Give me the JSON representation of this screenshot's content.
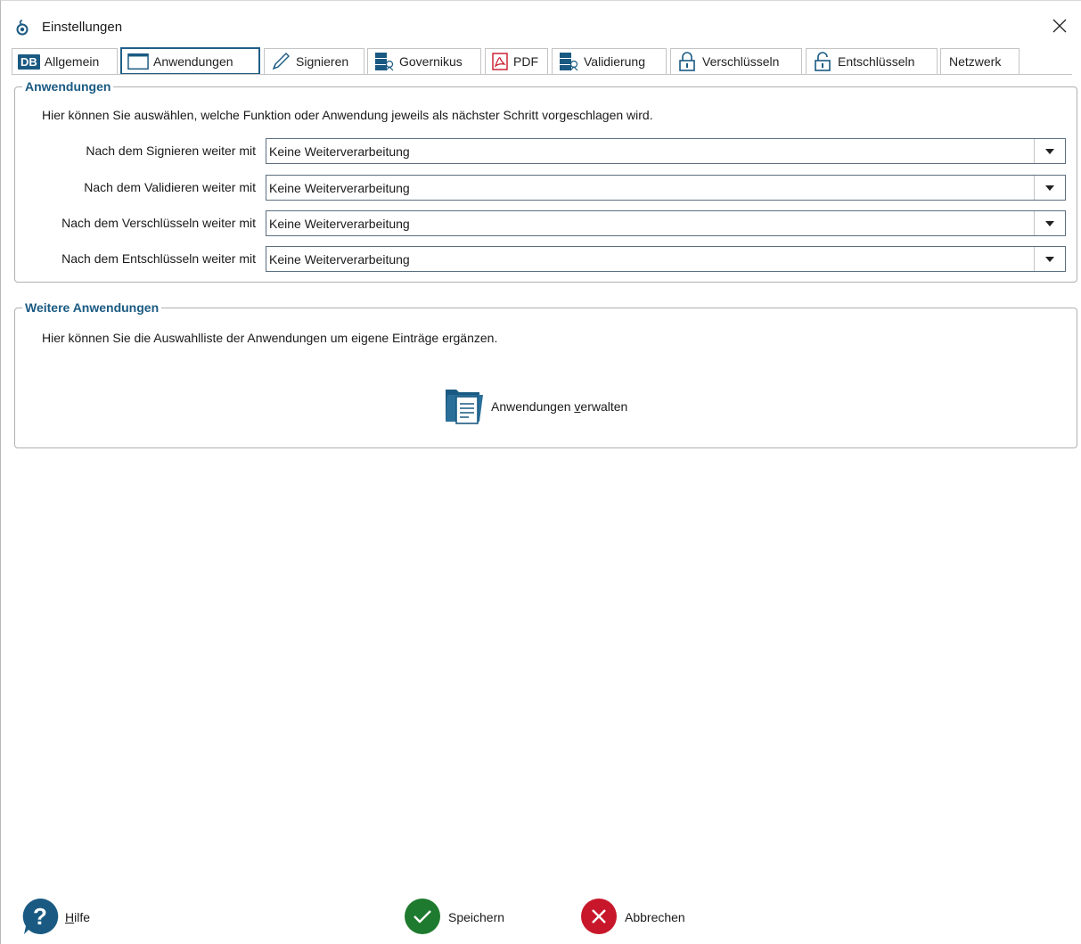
{
  "window": {
    "title": "Einstellungen",
    "title_icon": "app-logo-icon",
    "close_icon": "close-icon"
  },
  "tabs": [
    {
      "label": "Allgemein",
      "icon": "db-icon",
      "badge": "DB"
    },
    {
      "label": "Anwendungen",
      "icon": "window-icon",
      "active": true
    },
    {
      "label": "Signieren",
      "icon": "pen-icon"
    },
    {
      "label": "Governikus",
      "icon": "server-icon"
    },
    {
      "label": "PDF",
      "icon": "pdf-icon"
    },
    {
      "label": "Validierung",
      "icon": "server-check-icon"
    },
    {
      "label": "Verschlüsseln",
      "icon": "lock-closed-icon"
    },
    {
      "label": "Entschlüsseln",
      "icon": "lock-open-icon"
    },
    {
      "label": "Netzwerk",
      "icon": ""
    }
  ],
  "anwendungen": {
    "title": "Anwendungen",
    "description": "Hier können Sie auswählen, welche Funktion oder Anwendung jeweils als nächster Schritt vorgeschlagen wird.",
    "rows": [
      {
        "label": "Nach dem Signieren weiter mit",
        "value": "Keine Weiterverarbeitung"
      },
      {
        "label": "Nach dem Validieren weiter mit",
        "value": "Keine Weiterverarbeitung"
      },
      {
        "label": "Nach dem Verschlüsseln weiter mit",
        "value": "Keine Weiterverarbeitung"
      },
      {
        "label": "Nach dem Entschlüsseln weiter mit",
        "value": "Keine Weiterverarbeitung"
      }
    ]
  },
  "weitere": {
    "title": "Weitere Anwendungen",
    "description": "Hier können Sie die Auswahlliste der Anwendungen um eigene Einträge ergänzen.",
    "manage_button": {
      "label_before": "Anwendungen ",
      "label_mnemonic": "v",
      "label_after": "erwalten",
      "icon": "folder-document-icon"
    }
  },
  "footer": {
    "help": {
      "mnemonic": "H",
      "rest": "ilfe",
      "icon": "help-icon",
      "color": "#1a5a82"
    },
    "save": {
      "label": "Speichern",
      "icon": "check-icon",
      "color": "#1e7a2e"
    },
    "cancel": {
      "label": "Abbrechen",
      "icon": "x-icon",
      "color": "#c8172a"
    }
  },
  "colors": {
    "accent": "#1a5a82",
    "border": "#b0b0b0"
  }
}
